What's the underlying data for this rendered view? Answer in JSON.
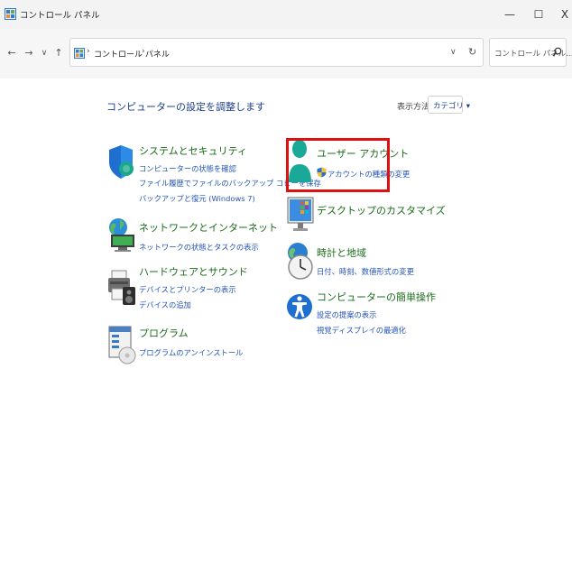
{
  "window": {
    "title": "コントロール パネル",
    "minimize": "—",
    "maximize": "☐",
    "close": "X"
  },
  "navigation": {
    "back": "←",
    "forward": "→",
    "recent": "∨",
    "up": "↑",
    "address_separator": "›",
    "address_path": "コントロール パネル",
    "address_dropdown": "∨",
    "refresh": "↻",
    "search_placeholder": "コントロール パネル..."
  },
  "main": {
    "heading": "コンピューターの設定を調整します",
    "view_by_label": "表示方法:",
    "view_by_value": "カテゴリ ▾"
  },
  "categories": {
    "system": {
      "title": "システムとセキュリティ",
      "links": [
        "コンピューターの状態を確認",
        "ファイル履歴でファイルのバックアップ コピーを保存",
        "バックアップと復元 (Windows 7)"
      ]
    },
    "network": {
      "title": "ネットワークとインターネット",
      "links": [
        "ネットワークの状態とタスクの表示"
      ]
    },
    "hardware": {
      "title": "ハードウェアとサウンド",
      "links": [
        "デバイスとプリンターの表示",
        "デバイスの追加"
      ]
    },
    "programs": {
      "title": "プログラム",
      "links": [
        "プログラムのアンインストール"
      ]
    },
    "user_accounts": {
      "title": "ユーザー アカウント",
      "links": [
        "アカウントの種類の変更"
      ]
    },
    "desktop": {
      "title": "デスクトップのカスタマイズ",
      "links": []
    },
    "clock": {
      "title": "時計と地域",
      "links": [
        "日付、時刻、数値形式の変更"
      ]
    },
    "ease": {
      "title": "コンピューターの簡単操作",
      "links": [
        "設定の提案の表示",
        "視覚ディスプレイの最適化"
      ]
    }
  },
  "colors": {
    "category_title": "#1a6b1a",
    "link": "#2453b8",
    "heading": "#1a3d8f",
    "highlight_border": "#e01010"
  }
}
